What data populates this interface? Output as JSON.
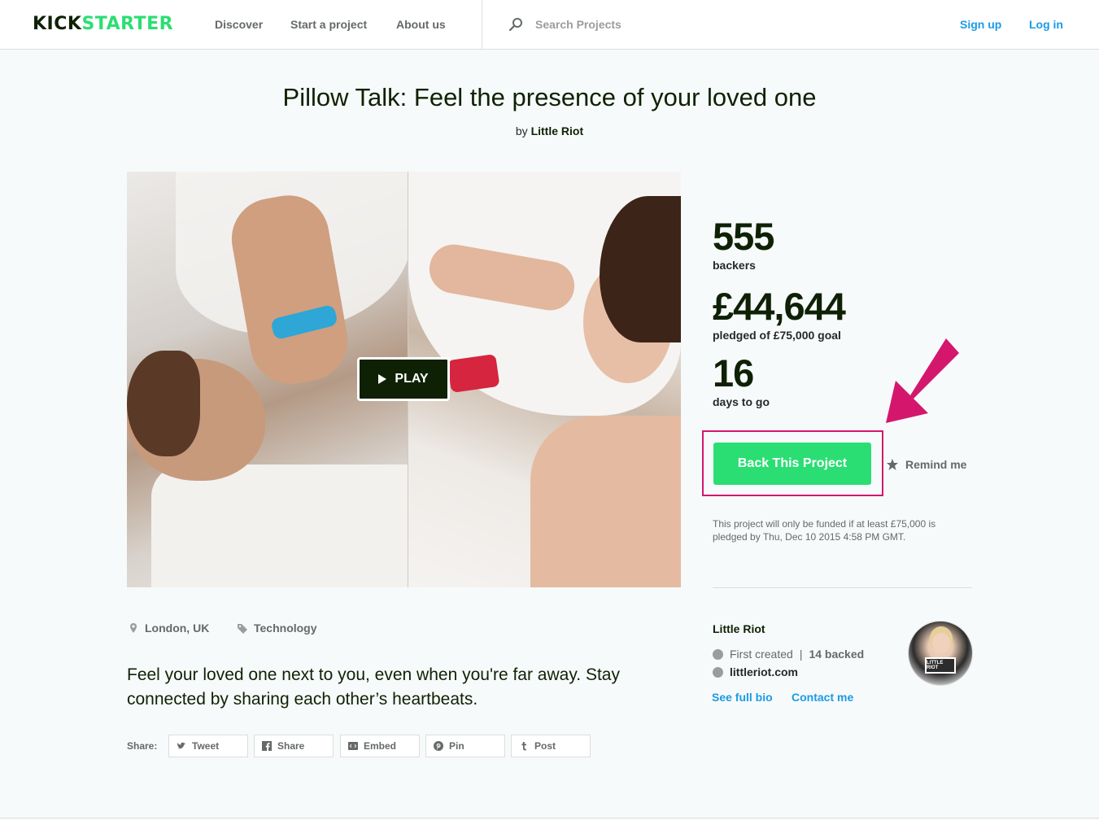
{
  "header": {
    "logo": {
      "part1": "KICK",
      "part2": "STARTER"
    },
    "nav": [
      "Discover",
      "Start a project",
      "About us"
    ],
    "search_placeholder": "Search Projects",
    "sign_up": "Sign up",
    "log_in": "Log in"
  },
  "project": {
    "title": "Pillow Talk: Feel the presence of your loved one",
    "by_prefix": "by",
    "creator": "Little Riot",
    "play_label": "PLAY",
    "location": "London, UK",
    "category": "Technology",
    "blurb": "Feel your loved one next to you, even when you're far away. Stay connected by sharing each other’s heartbeats."
  },
  "stats": {
    "backers": "555",
    "backers_label": "backers",
    "pledged": "£44,644",
    "pledged_label": "pledged of £75,000 goal",
    "days": "16",
    "days_label": "days to go"
  },
  "actions": {
    "back_label": "Back This Project",
    "remind_label": "Remind me",
    "funding_note": "This project will only be funded if at least £75,000 is pledged by Thu, Dec 10 2015 4:58 PM GMT."
  },
  "creator": {
    "name": "Little Riot",
    "first_created": "First created",
    "separator": "|",
    "backed": "14 backed",
    "website": "littleriot.com",
    "see_bio": "See full bio",
    "contact": "Contact me",
    "avatar_sign": "LITTLE RIOT"
  },
  "share": {
    "label": "Share:",
    "buttons": [
      "Tweet",
      "Share",
      "Embed",
      "Pin",
      "Post"
    ]
  },
  "colors": {
    "brand_green": "#2bde73",
    "dark_green": "#0f2105",
    "link_blue": "#1a9be6",
    "highlight_pink": "#d4176d"
  }
}
